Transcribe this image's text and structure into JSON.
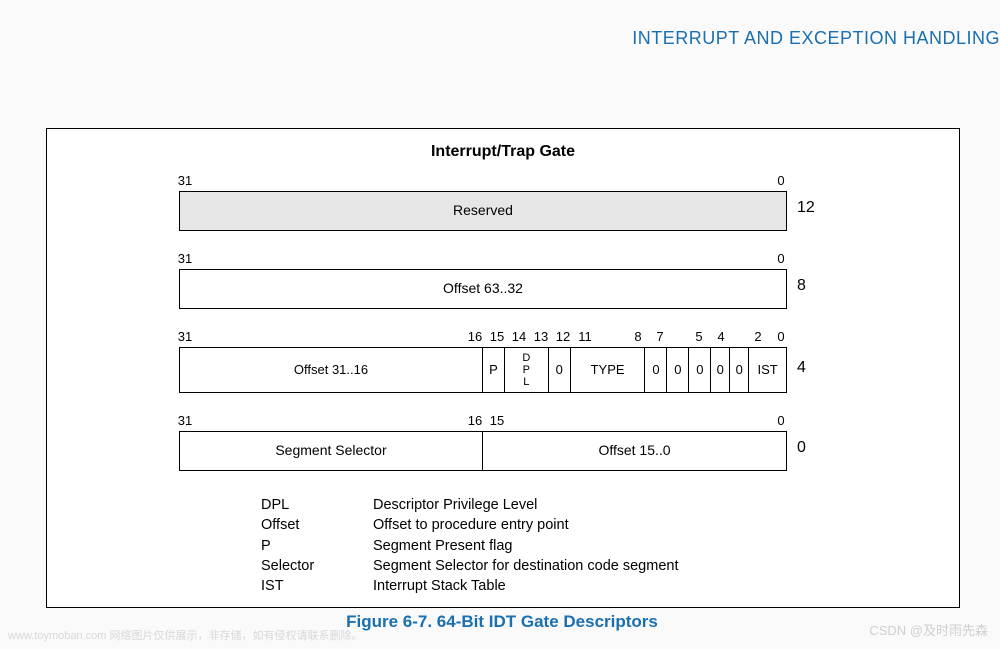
{
  "header": {
    "title": "INTERRUPT AND EXCEPTION HANDLING"
  },
  "figure": {
    "gate_title": "Interrupt/Trap Gate",
    "caption": "Figure 6-7.  64-Bit IDT Gate Descriptors"
  },
  "rows": {
    "r12": {
      "offset": "12",
      "bits": {
        "left": "31",
        "right": "0"
      },
      "fields": {
        "reserved": "Reserved"
      }
    },
    "r8": {
      "offset": "8",
      "bits": {
        "left": "31",
        "right": "0"
      },
      "fields": {
        "offset63_32": "Offset 63..32"
      }
    },
    "r4": {
      "offset": "4",
      "bits": {
        "b31": "31",
        "b16": "16",
        "b15": "15",
        "b14": "14",
        "b13": "13",
        "b12": "12",
        "b11": "11",
        "b8": "8",
        "b7": "7",
        "b5": "5",
        "b4": "4",
        "b2": "2",
        "b0": "0"
      },
      "fields": {
        "offset31_16": "Offset 31..16",
        "p": "P",
        "dpl": "D\nP\nL",
        "zero_a": "0",
        "type": "TYPE",
        "z1": "0",
        "z2": "0",
        "z3": "0",
        "z4": "0",
        "z5": "0",
        "ist": "IST"
      }
    },
    "r0": {
      "offset": "0",
      "bits": {
        "b31": "31",
        "b16": "16",
        "b15": "15",
        "b0": "0"
      },
      "fields": {
        "segsel": "Segment Selector",
        "offset15_0": "Offset 15..0"
      }
    }
  },
  "legend": [
    {
      "term": "DPL",
      "desc": "Descriptor Privilege Level"
    },
    {
      "term": "Offset",
      "desc": "Offset to procedure entry point"
    },
    {
      "term": "P",
      "desc": "Segment Present flag"
    },
    {
      "term": "Selector",
      "desc": "Segment Selector for destination code segment"
    },
    {
      "term": "IST",
      "desc": "Interrupt Stack Table"
    }
  ],
  "watermarks": {
    "csdn": "CSDN @及时雨先森",
    "left": "www.toymoban.com  网络图片仅供展示，非存储，如有侵权请联系删除。"
  }
}
